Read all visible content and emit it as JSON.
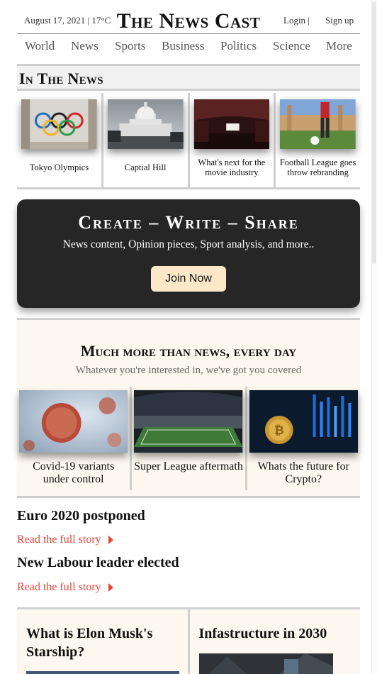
{
  "header": {
    "date_weather": "August 17, 2021 | 17°C",
    "brand": "The News Cast",
    "login_label": "Login |",
    "signup_label": "Sign up"
  },
  "nav": {
    "items": [
      "World",
      "News",
      "Sports",
      "Business",
      "Politics",
      "Science",
      "More"
    ]
  },
  "in_the_news": {
    "heading": "In The News",
    "cards": [
      {
        "caption": "Tokyo Olympics",
        "image": "olympic-rings-photo"
      },
      {
        "caption": "Captial Hill",
        "image": "capitol-building-photo"
      },
      {
        "caption": "What's next for the movie industry",
        "image": "movie-theatre-photo"
      },
      {
        "caption": "Football League goes throw rebranding",
        "image": "football-player-photo"
      }
    ]
  },
  "banner": {
    "title": "Create – Write – Share",
    "subtitle": "News content, Opinion pieces, Sport analysis, and more..",
    "button_label": "Join Now"
  },
  "more_section": {
    "title": "Much more than news, every day",
    "subtitle": "Whatever you're interested in, we've got you covered",
    "cards": [
      {
        "caption": "Covid-19 variants under control",
        "image": "virus-photo"
      },
      {
        "caption": "Super League aftermath",
        "image": "stadium-photo"
      },
      {
        "caption": "Whats the future for Crypto?",
        "image": "bitcoin-photo"
      }
    ]
  },
  "stories": [
    {
      "title": "Euro 2020 postponed",
      "link": "Read the full story"
    },
    {
      "title": "New Labour leader elected",
      "link": "Read the full story"
    }
  ],
  "bottom": {
    "left_title": "What is Elon Musk's Starship?",
    "right_title": "Infastructure in 2030"
  },
  "colors": {
    "accent_red": "#e8453c",
    "banner_bg": "#262626",
    "button_bg": "#fde7c9",
    "section_bg": "#fdf8ef"
  }
}
